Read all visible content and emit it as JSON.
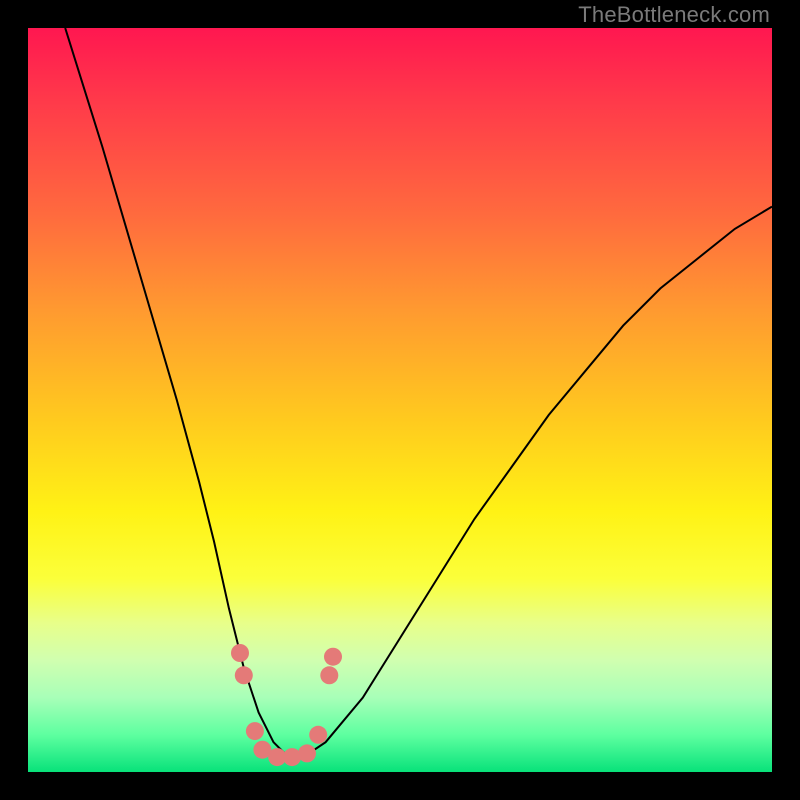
{
  "watermark": "TheBottleneck.com",
  "chart_data": {
    "type": "line",
    "title": "",
    "xlabel": "",
    "ylabel": "",
    "xlim": [
      0,
      100
    ],
    "ylim": [
      0,
      100
    ],
    "grid": false,
    "legend": false,
    "series": [
      {
        "name": "curve",
        "x": [
          5,
          10,
          15,
          20,
          23,
          25,
          27,
          29,
          31,
          33,
          35,
          37,
          40,
          45,
          50,
          55,
          60,
          65,
          70,
          75,
          80,
          85,
          90,
          95,
          100
        ],
        "values": [
          100,
          84,
          67,
          50,
          39,
          31,
          22,
          14,
          8,
          4,
          2,
          2,
          4,
          10,
          18,
          26,
          34,
          41,
          48,
          54,
          60,
          65,
          69,
          73,
          76
        ]
      }
    ],
    "markers": [
      {
        "x": 28.5,
        "y": 16.0
      },
      {
        "x": 29.0,
        "y": 13.0
      },
      {
        "x": 30.5,
        "y": 5.5
      },
      {
        "x": 31.5,
        "y": 3.0
      },
      {
        "x": 33.5,
        "y": 2.0
      },
      {
        "x": 35.5,
        "y": 2.0
      },
      {
        "x": 37.5,
        "y": 2.5
      },
      {
        "x": 39.0,
        "y": 5.0
      },
      {
        "x": 40.5,
        "y": 13.0
      },
      {
        "x": 41.0,
        "y": 15.5
      }
    ],
    "background_gradient": {
      "top": "#ff1750",
      "mid": "#fff215",
      "bottom": "#08e27a"
    }
  }
}
